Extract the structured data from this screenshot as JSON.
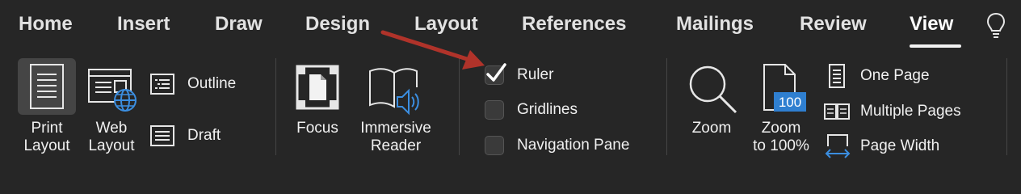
{
  "tabs": [
    {
      "label": "Home"
    },
    {
      "label": "Insert"
    },
    {
      "label": "Draw"
    },
    {
      "label": "Design"
    },
    {
      "label": "Layout"
    },
    {
      "label": "References"
    },
    {
      "label": "Mailings"
    },
    {
      "label": "Review"
    },
    {
      "label": "View",
      "active": true
    }
  ],
  "views": {
    "print_layout": "Print\nLayout",
    "web_layout": "Web\nLayout",
    "outline": "Outline",
    "draft": "Draft"
  },
  "immersive": {
    "focus": "Focus",
    "immersive_reader": "Immersive\nReader"
  },
  "show": {
    "ruler": {
      "label": "Ruler",
      "checked": true
    },
    "gridlines": {
      "label": "Gridlines",
      "checked": false
    },
    "navigation_pane": {
      "label": "Navigation Pane",
      "checked": false
    }
  },
  "zoom": {
    "zoom": "Zoom",
    "zoom_100": "Zoom\nto 100%",
    "zoom_100_badge": "100",
    "one_page": "One Page",
    "multiple_pages": "Multiple Pages",
    "page_width": "Page Width"
  },
  "colors": {
    "background": "#262626",
    "annotation_arrow": "#b0332a",
    "badge": "#2f7fd0",
    "globe": "#3b8ee0"
  }
}
